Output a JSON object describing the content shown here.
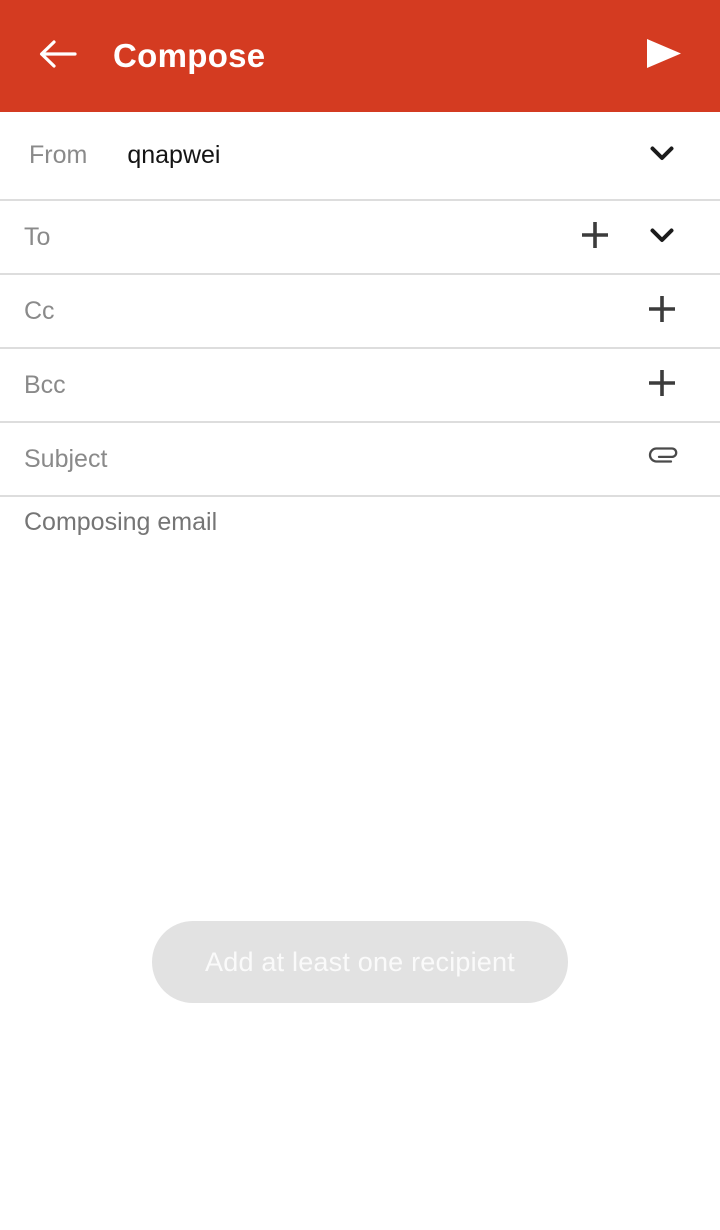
{
  "appbar": {
    "back_icon": "arrow-left-icon",
    "title": "Compose",
    "send_icon": "send-icon",
    "background_color": "#d43b21",
    "foreground_color": "#ffffff"
  },
  "fields": {
    "from": {
      "label": "From",
      "value": "qnapwei",
      "dropdown_icon": "chevron-down-icon"
    },
    "to": {
      "label": "To",
      "value": "",
      "add_icon": "plus-icon",
      "dropdown_icon": "chevron-down-icon"
    },
    "cc": {
      "label": "Cc",
      "value": "",
      "add_icon": "plus-icon"
    },
    "bcc": {
      "label": "Bcc",
      "value": "",
      "add_icon": "plus-icon"
    },
    "subject": {
      "label": "Subject",
      "value": "",
      "attach_icon": "paperclip-icon"
    }
  },
  "body": {
    "placeholder": "Composing email",
    "value": ""
  },
  "toast": {
    "message": "Add at least one recipient",
    "background_color": "#e2e2e2",
    "text_color": "#fafafa"
  },
  "divider_color": "#dddddd"
}
